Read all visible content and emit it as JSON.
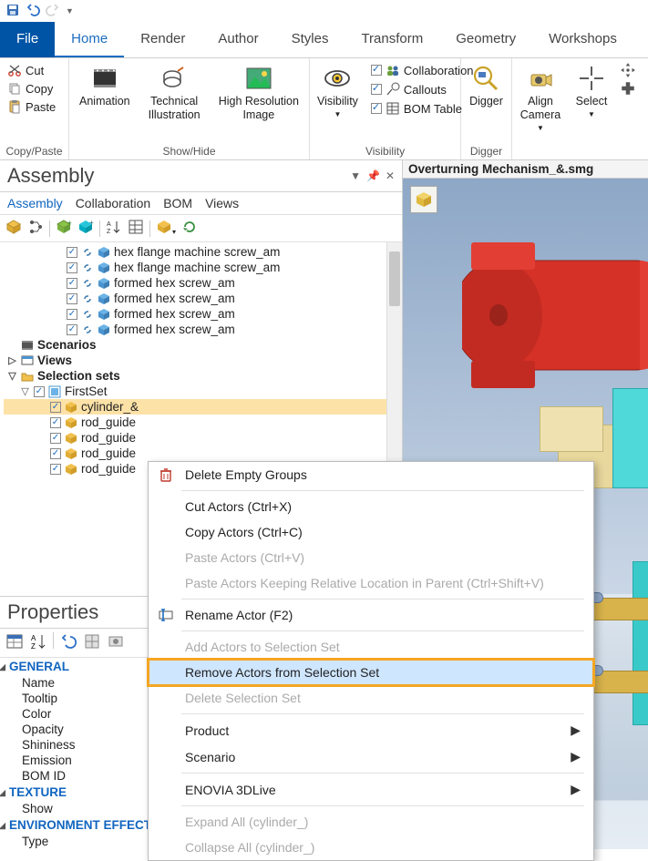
{
  "qat_tips": [
    "Save",
    "Undo",
    "Redo"
  ],
  "tabs": [
    "File",
    "Home",
    "Render",
    "Author",
    "Styles",
    "Transform",
    "Geometry",
    "Workshops"
  ],
  "active_tab": "Home",
  "ribbon": {
    "copy_paste": {
      "cut": "Cut",
      "copy": "Copy",
      "paste": "Paste",
      "label": "Copy/Paste"
    },
    "show_hide": {
      "animation": "Animation",
      "tech_illus": "Technical\nIllustration",
      "hires": "High Resolution\nImage",
      "label": "Show/Hide"
    },
    "visibility": {
      "visibility": "Visibility",
      "collaboration": "Collaboration",
      "callouts": "Callouts",
      "bom": "BOM Table",
      "label": "Visibility"
    },
    "digger": {
      "digger": "Digger",
      "label": "Digger"
    },
    "camera": {
      "align": "Align\nCamera"
    },
    "select": {
      "select": "Select"
    }
  },
  "assembly_panel": {
    "title": "Assembly",
    "subtabs": [
      "Assembly",
      "Collaboration",
      "BOM",
      "Views"
    ],
    "tree": [
      {
        "l": 4,
        "c": true,
        "t": "hex flange machine screw_am"
      },
      {
        "l": 4,
        "c": true,
        "t": "hex flange machine screw_am"
      },
      {
        "l": 4,
        "c": true,
        "t": "formed hex screw_am"
      },
      {
        "l": 4,
        "c": true,
        "t": "formed hex screw_am"
      },
      {
        "l": 4,
        "c": true,
        "t": "formed hex screw_am"
      },
      {
        "l": 4,
        "c": true,
        "t": "formed hex screw_am"
      }
    ],
    "scenarios": "Scenarios",
    "views": "Views",
    "selection_sets": "Selection sets",
    "first_set": "FirstSet",
    "set_items": [
      {
        "t": "cylinder_&",
        "sel": true,
        "c": true
      },
      {
        "t": "rod_guide",
        "c": true
      },
      {
        "t": "rod_guide",
        "c": true
      },
      {
        "t": "rod_guide",
        "c": true
      },
      {
        "t": "rod_guide",
        "c": true
      }
    ]
  },
  "properties_panel": {
    "title": "Properties",
    "groups": [
      {
        "name": "GENERAL",
        "rows": [
          "Name",
          "Tooltip",
          "Color",
          "Opacity",
          "Shininess",
          "Emission",
          "BOM ID"
        ]
      },
      {
        "name": "TEXTURE",
        "rows": [
          "Show"
        ]
      },
      {
        "name": "ENVIRONMENT EFFECT",
        "rows": [
          "Type"
        ]
      }
    ]
  },
  "document_tab": "Overturning Mechanism_&.smg",
  "context_menu": [
    {
      "t": "Delete Empty Groups",
      "icon": "delete"
    },
    {
      "sep": true
    },
    {
      "t": "Cut Actors (Ctrl+X)"
    },
    {
      "t": "Copy Actors (Ctrl+C)"
    },
    {
      "t": "Paste Actors (Ctrl+V)",
      "disabled": true
    },
    {
      "t": "Paste Actors Keeping Relative Location in Parent (Ctrl+Shift+V)",
      "disabled": true
    },
    {
      "sep": true
    },
    {
      "t": "Rename Actor (F2)",
      "icon": "rename"
    },
    {
      "sep": true
    },
    {
      "t": "Add Actors to Selection Set",
      "disabled": true
    },
    {
      "t": "Remove Actors from Selection Set",
      "highlight": true
    },
    {
      "t": "Delete Selection Set",
      "disabled": true
    },
    {
      "sep": true
    },
    {
      "t": "Product",
      "sub": true
    },
    {
      "t": "Scenario",
      "sub": true
    },
    {
      "sep": true
    },
    {
      "t": "ENOVIA 3DLive",
      "sub": true
    },
    {
      "sep": true
    },
    {
      "t": "Expand All (cylinder_)",
      "disabled": true
    },
    {
      "t": "Collapse All (cylinder_)",
      "disabled": true
    }
  ]
}
